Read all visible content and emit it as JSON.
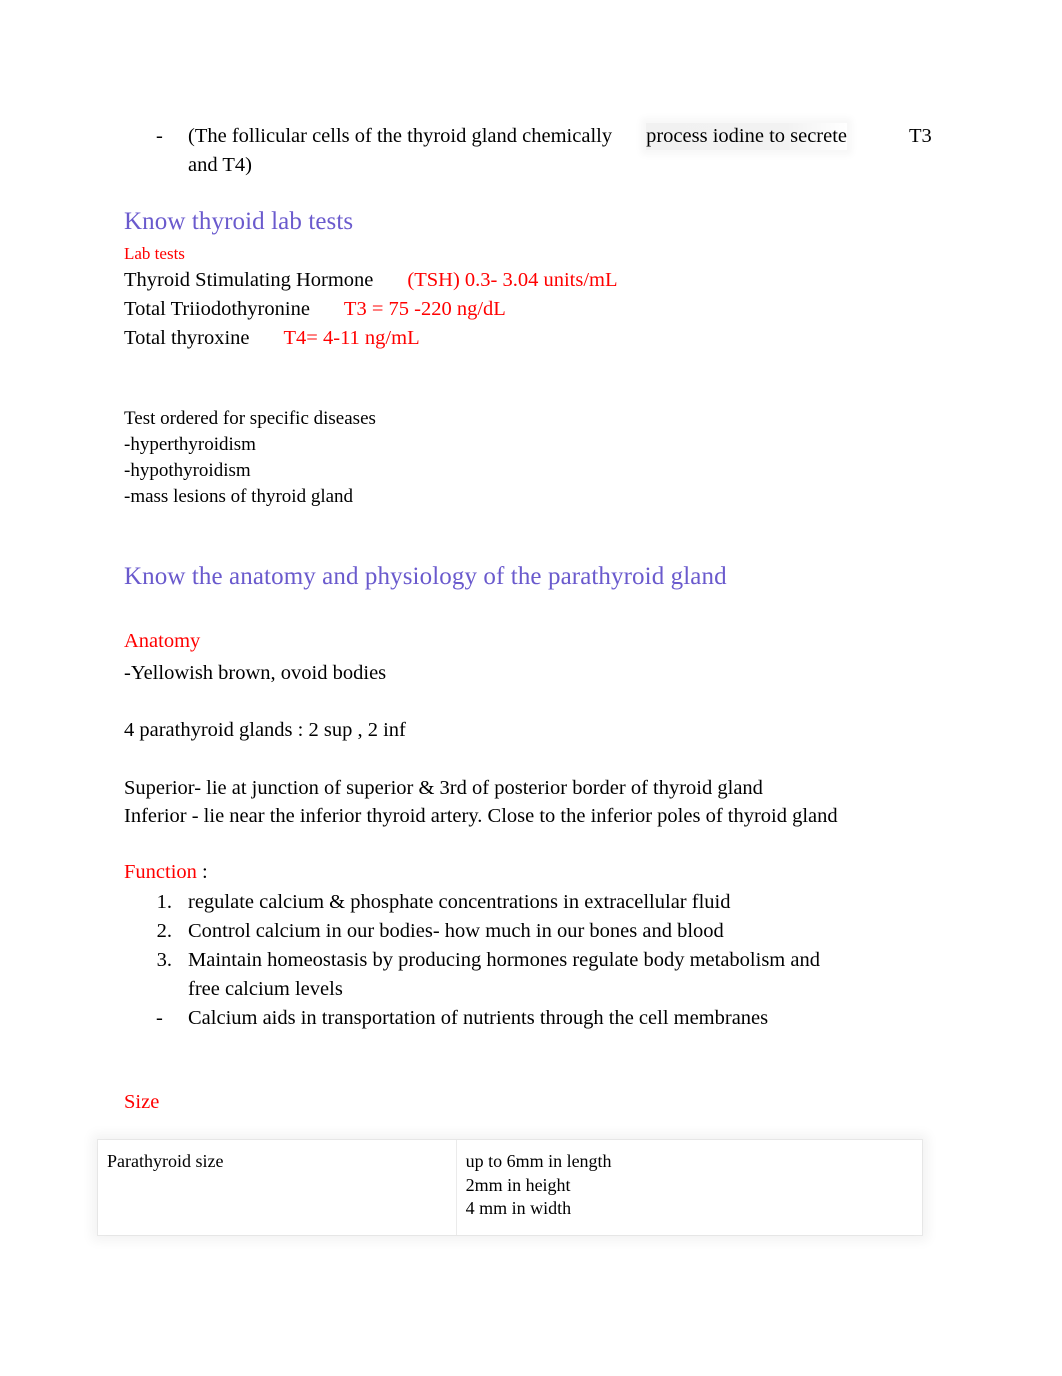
{
  "document": {
    "intro": {
      "marker": "-",
      "text_part1": "(The follicular cells of the thyroid gland chemically",
      "text_shaded": "process iodine to secrete",
      "text_part2": "T3",
      "text_line2": "and T4)"
    },
    "sections": [
      {
        "heading": "Know thyroid lab tests",
        "label": "Lab tests",
        "lab_tests": [
          {
            "name": "Thyroid Stimulating Hormone",
            "value": "(TSH) 0.3- 3.04 units/mL"
          },
          {
            "name": "Total Triiodothyronine",
            "value": "T3 = 75 -220 ng/dL"
          },
          {
            "name": "Total thyroxine",
            "value": "T4= 4-11 ng/mL"
          }
        ],
        "ordered_for": {
          "title": "Test ordered for specific diseases",
          "items": [
            "-hyperthyroidism",
            "-hypothyroidism",
            "-mass lesions of thyroid gland"
          ]
        }
      },
      {
        "heading": "Know the anatomy and physiology of the parathyroid gland",
        "anatomy_label": "Anatomy",
        "anatomy_desc": "-Yellowish brown, ovoid bodies",
        "glands_count": "4 parathyroid glands : 2 sup , 2 inf",
        "position_superior": "Superior- lie at junction of superior & 3rd of posterior border of thyroid gland",
        "position_inferior": "Inferior - lie near the inferior thyroid artery. Close to the inferior poles of thyroid gland",
        "function_label": "Function",
        "function_colon": " :",
        "function_items": [
          {
            "marker": "1.",
            "text": "regulate calcium & phosphate concentrations in extracellular fluid"
          },
          {
            "marker": "2.",
            "text": "Control calcium in our bodies- how much in our bones and blood"
          },
          {
            "marker": "3.",
            "text": "Maintain homeostasis by producing hormones regulate body metabolism and"
          },
          {
            "marker": "",
            "text": "free calcium levels"
          },
          {
            "marker": "-",
            "text": "Calcium aids in transportation of nutrients through the cell membranes"
          }
        ],
        "size_label": "Size",
        "size_table": {
          "row_label": "Parathyroid size",
          "values": [
            "up to 6mm in length",
            "2mm in height",
            "4 mm in width"
          ]
        }
      }
    ],
    "colors": {
      "heading": "#6A5ACD",
      "accent_red": "#FF0000",
      "text": "#000000",
      "page_background": "#FFFFFF"
    }
  }
}
